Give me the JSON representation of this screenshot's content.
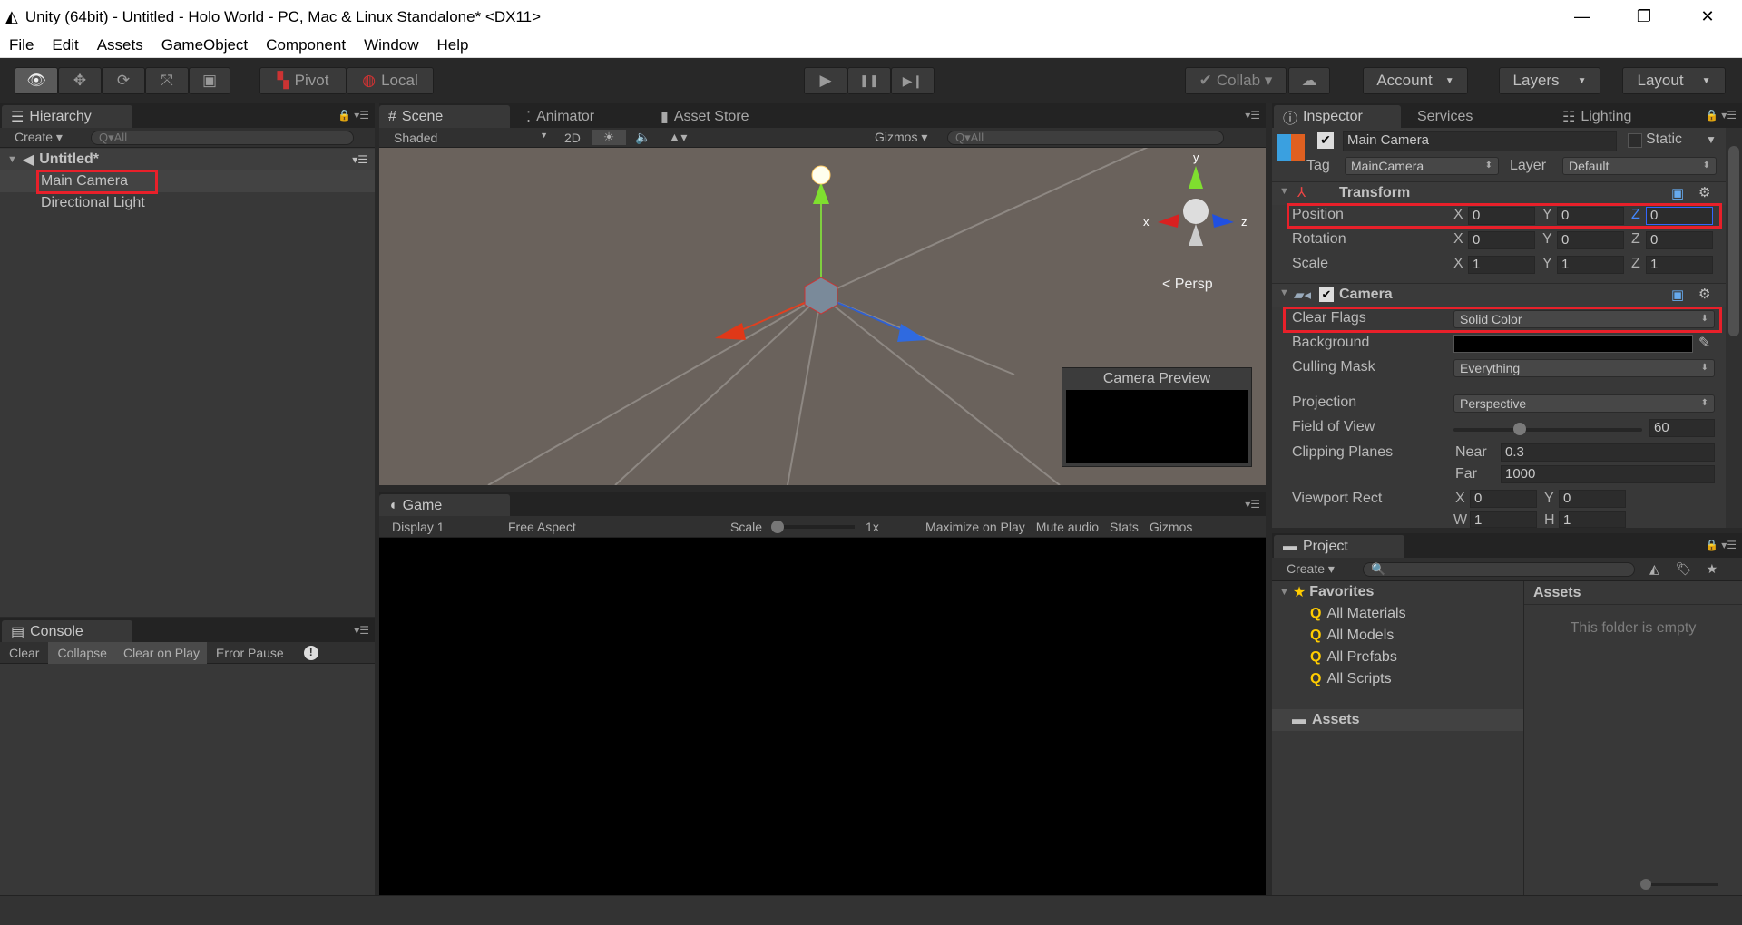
{
  "window": {
    "title": "Unity (64bit) - Untitled - Holo World - PC, Mac & Linux Standalone* <DX11>",
    "minimize": "—",
    "restore": "❐",
    "close": "✕"
  },
  "menu": [
    "File",
    "Edit",
    "Assets",
    "GameObject",
    "Component",
    "Window",
    "Help"
  ],
  "toolbar": {
    "pivot": "Pivot",
    "local": "Local",
    "collab": "Collab ▾",
    "account": "Account",
    "layers": "Layers",
    "layout": "Layout",
    "play": "▶",
    "pause": "❚❚",
    "step": "▶❙"
  },
  "hierarchy": {
    "tab": "Hierarchy",
    "create": "Create ▾",
    "search_placeholder": "Q▾All",
    "scene": "Untitled*",
    "items": [
      "Main Camera",
      "Directional Light"
    ]
  },
  "scene": {
    "tabs": [
      "Scene",
      "Animator",
      "Asset Store"
    ],
    "shading": "Shaded",
    "mode_2d": "2D",
    "gizmos": "Gizmos ▾",
    "search_placeholder": "Q▾All",
    "persp": "Persp",
    "camera_preview": "Camera Preview",
    "axes": {
      "x": "x",
      "y": "y",
      "z": "z"
    }
  },
  "game": {
    "tab": "Game",
    "display": "Display 1",
    "aspect": "Free Aspect",
    "scale_label": "Scale",
    "scale_value": "1x",
    "maximize": "Maximize on Play",
    "mute": "Mute audio",
    "stats": "Stats",
    "gizmos": "Gizmos"
  },
  "console": {
    "tab": "Console",
    "buttons": [
      "Clear",
      "Collapse",
      "Clear on Play",
      "Error Pause"
    ]
  },
  "inspector": {
    "tabs": [
      "Inspector",
      "Services",
      "Lighting"
    ],
    "object_name": "Main Camera",
    "static": "Static",
    "tag_label": "Tag",
    "tag": "MainCamera",
    "layer_label": "Layer",
    "layer": "Default",
    "transform": {
      "title": "Transform",
      "rows": [
        {
          "label": "Position",
          "x": "0",
          "y": "0",
          "z": "0"
        },
        {
          "label": "Rotation",
          "x": "0",
          "y": "0",
          "z": "0"
        },
        {
          "label": "Scale",
          "x": "1",
          "y": "1",
          "z": "1"
        }
      ]
    },
    "camera": {
      "title": "Camera",
      "clear_flags_label": "Clear Flags",
      "clear_flags": "Solid Color",
      "background_label": "Background",
      "background_color": "#000000",
      "culling_label": "Culling Mask",
      "culling": "Everything",
      "projection_label": "Projection",
      "projection": "Perspective",
      "fov_label": "Field of View",
      "fov": "60",
      "fov_fraction": 0.35,
      "clip_label": "Clipping Planes",
      "near_label": "Near",
      "near": "0.3",
      "far_label": "Far",
      "far": "1000",
      "viewport_label": "Viewport Rect",
      "vx": "0",
      "vy": "0",
      "vw": "1",
      "vh": "1"
    }
  },
  "project": {
    "tab": "Project",
    "create": "Create ▾",
    "favorites": "Favorites",
    "fav_items": [
      "All Materials",
      "All Models",
      "All Prefabs",
      "All Scripts"
    ],
    "assets": "Assets",
    "assets_header": "Assets",
    "empty": "This folder is empty"
  },
  "colors": {
    "highlight": "#e8202a",
    "panel": "#383838"
  }
}
